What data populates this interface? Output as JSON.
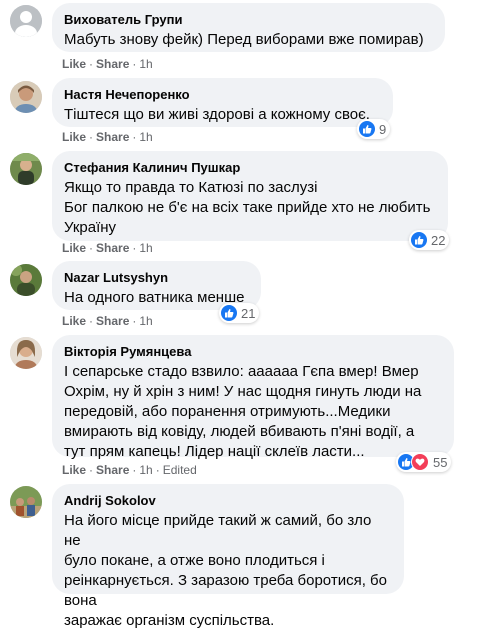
{
  "comments": [
    {
      "author": "Вихователь Групи",
      "text": "Мабуть знову фейк) Перед виборами вже помирав)",
      "like": "Like",
      "share": "Share",
      "time": "1h"
    },
    {
      "author": "Настя Нечепоренко",
      "text": "Тіштеся що ви живі здорові а кожному своє.",
      "like": "Like",
      "share": "Share",
      "time": "1h",
      "reactions": "9"
    },
    {
      "author": "Стефания Калинич Пушкар",
      "text_lines": [
        "Якщо то правда то Катюзі по заслузі",
        "Бог палкою не б'є на всіх таке прийде хто не любить",
        "Україну"
      ],
      "like": "Like",
      "share": "Share",
      "time": "1h",
      "reactions": "22"
    },
    {
      "author": "Nazar Lutsyshyn",
      "text": "На одного ватника менше",
      "like": "Like",
      "share": "Share",
      "time": "1h",
      "reactions": "21"
    },
    {
      "author": "Вікторія Румянцева",
      "text_lines": [
        "І сепарське стадо взвило: аааааа Гєпа вмер! Вмер",
        "Охрім, ну й хрін з ним! У нас щодня гинуть люди на",
        "передовій, або поранення отримують...Медики",
        "вмирають від ковіду, людей вбивають п'яні водії, а",
        "тут прям капець! Лідер нації склеїв ласти..."
      ],
      "like": "Like",
      "share": "Share",
      "time": "1h",
      "edited": "Edited",
      "reactions": "55"
    },
    {
      "author": "Andrij Sokolov",
      "text_lines": [
        "На його місце прийде такий ж самий, бо зло не",
        "було покане, а отже воно плодиться і",
        "реінкарнується. З заразою треба боротися, бо вона",
        "заражає організм суспільства."
      ]
    }
  ],
  "colors": {
    "bubble": "#f0f2f5",
    "meta": "#65676b",
    "like_blue": "#1877f2",
    "love_red": "#f33e58"
  }
}
